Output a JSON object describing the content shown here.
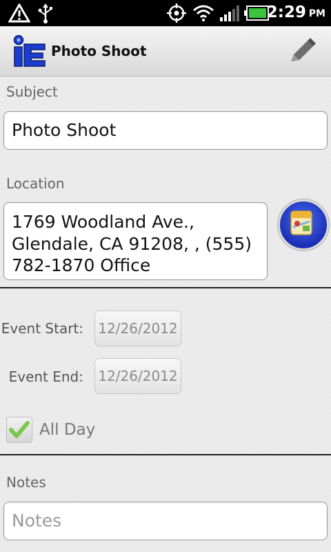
{
  "status_bar": {
    "time": "2:29",
    "ampm": "PM",
    "icons": [
      "warning-icon",
      "usb-icon",
      "gps-icon",
      "wifi-icon",
      "signal-icon",
      "battery-icon"
    ]
  },
  "app": {
    "title": "Photo Shoot",
    "logo_icon": "app-logo-icon",
    "edit_icon": "pencil-icon"
  },
  "form": {
    "subject_label": "Subject",
    "subject_value": "Photo Shoot",
    "location_label": "Location",
    "location_lines": [
      "1769 Woodland Ave.,",
      "Glendale, CA  91208, , (555)",
      "782-1870 Office"
    ],
    "event_start_label": "Event Start:",
    "event_start_value": "12/26/2012",
    "event_end_label": "Event End:",
    "event_end_value": "12/26/2012",
    "all_day_label": "All Day",
    "all_day_checked": true,
    "notes_label": "Notes",
    "notes_placeholder": "Notes"
  },
  "colors": {
    "accent_blue": "#1a3fd0",
    "check_green": "#7ac84a"
  }
}
